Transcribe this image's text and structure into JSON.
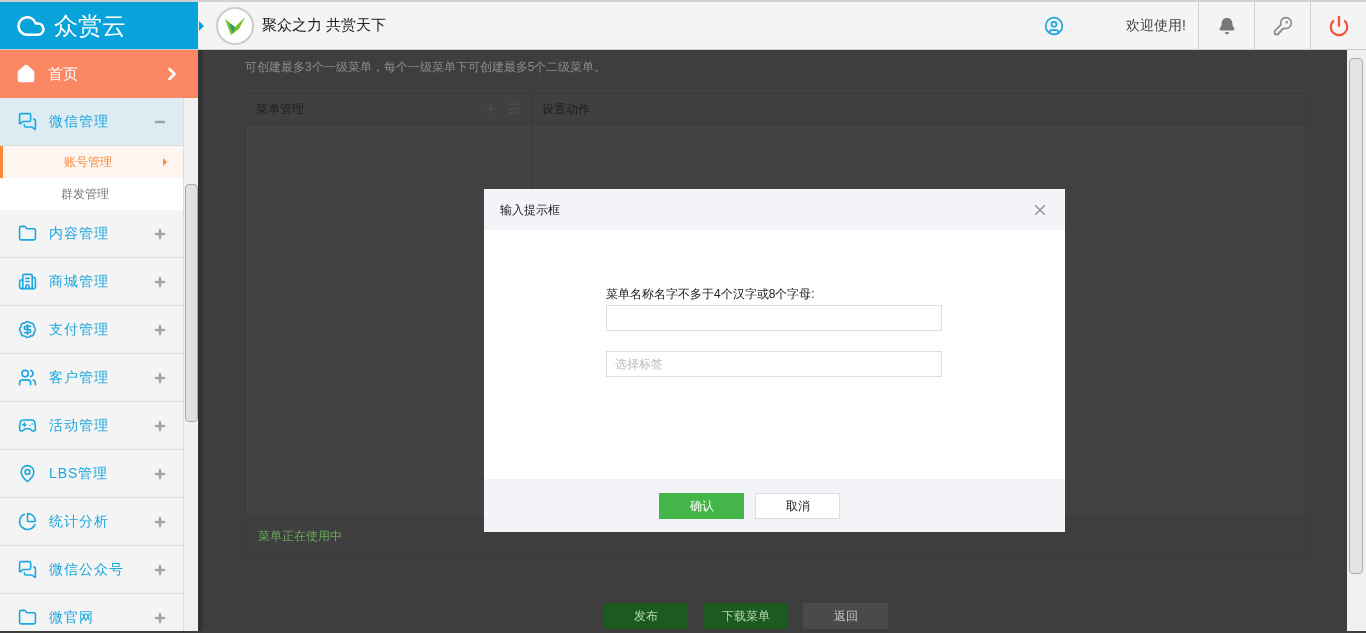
{
  "header": {
    "logo": "众赏云",
    "slogan": "聚众之力 共赏天下",
    "welcome": "欢迎使用!"
  },
  "sidebar": {
    "items": [
      {
        "kind": "home",
        "label": "首页"
      },
      {
        "kind": "group",
        "label": "微信管理",
        "expanded": true,
        "children": [
          {
            "label": "账号管理",
            "selected": true
          },
          {
            "label": "群发管理",
            "selected": false
          }
        ]
      },
      {
        "kind": "group",
        "label": "内容管理",
        "expanded": false
      },
      {
        "kind": "group",
        "label": "商城管理",
        "expanded": false
      },
      {
        "kind": "group",
        "label": "支付管理",
        "expanded": false
      },
      {
        "kind": "group",
        "label": "客户管理",
        "expanded": false
      },
      {
        "kind": "group",
        "label": "活动管理",
        "expanded": false
      },
      {
        "kind": "group",
        "label": "LBS管理",
        "expanded": false
      },
      {
        "kind": "group",
        "label": "统计分析",
        "expanded": false
      },
      {
        "kind": "group",
        "label": "微信公众号",
        "expanded": false
      },
      {
        "kind": "group",
        "label": "微官网",
        "expanded": false
      }
    ]
  },
  "page": {
    "notice": "可创建最多3个一级菜单，每个一级菜单下可创建最多5个二级菜单。",
    "columns": [
      "菜单管理",
      "设置动作"
    ],
    "status": "菜单正在使用中",
    "buttons": [
      {
        "label": "发布",
        "kind": "primary"
      },
      {
        "label": "下载菜单",
        "kind": "primary"
      },
      {
        "label": "返回",
        "kind": "default"
      }
    ]
  },
  "dialog": {
    "title": "输入提示框",
    "field_label": "菜单名称名字不多于4个汉字或8个字母:",
    "tag_placeholder": "选择标签",
    "buttons": [
      {
        "label": "确认",
        "kind": "primary"
      },
      {
        "label": "取消",
        "kind": "default"
      }
    ]
  }
}
